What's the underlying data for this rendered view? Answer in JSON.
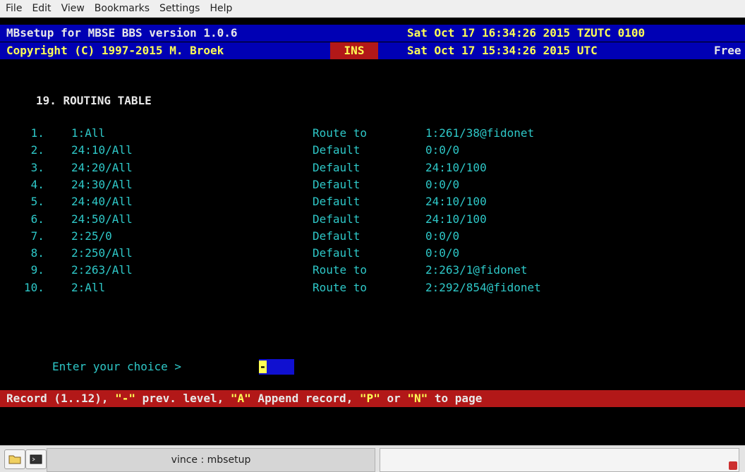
{
  "menu": [
    "File",
    "Edit",
    "View",
    "Bookmarks",
    "Settings",
    "Help"
  ],
  "header": {
    "title": "MBsetup for MBSE BBS version 1.0.6",
    "copyright": "Copyright (C) 1997-2015 M. Broek",
    "mode": "INS",
    "local_time": "Sat Oct 17 16:34:26 2015 TZUTC 0100",
    "utc_time": "Sat Oct 17 15:34:26 2015 UTC",
    "free": "Free"
  },
  "screen_title": "19. ROUTING TABLE",
  "routes": [
    {
      "num": " 1.",
      "pattern": "1:All",
      "action": "Route to",
      "target": "1:261/38@fidonet"
    },
    {
      "num": " 2.",
      "pattern": "24:10/All",
      "action": "Default",
      "target": "0:0/0"
    },
    {
      "num": " 3.",
      "pattern": "24:20/All",
      "action": "Default",
      "target": "24:10/100"
    },
    {
      "num": " 4.",
      "pattern": "24:30/All",
      "action": "Default",
      "target": "0:0/0"
    },
    {
      "num": " 5.",
      "pattern": "24:40/All",
      "action": "Default",
      "target": "24:10/100"
    },
    {
      "num": " 6.",
      "pattern": "24:50/All",
      "action": "Default",
      "target": "24:10/100"
    },
    {
      "num": " 7.",
      "pattern": "2:25/0",
      "action": "Default",
      "target": "0:0/0"
    },
    {
      "num": " 8.",
      "pattern": "2:250/All",
      "action": "Default",
      "target": "0:0/0"
    },
    {
      "num": " 9.",
      "pattern": "2:263/All",
      "action": "Route to",
      "target": "2:263/1@fidonet"
    },
    {
      "num": "10.",
      "pattern": "2:All",
      "action": "Route to",
      "target": "2:292/854@fidonet"
    }
  ],
  "prompt": "Enter your choice >",
  "input_value": "-",
  "status": {
    "p1": "Record (1..12), ",
    "k1": "\"-\"",
    "p2": " prev. level, ",
    "k2": "\"A\"",
    "p3": " Append record, ",
    "k3": "\"P\"",
    "p4": " or ",
    "k4": "\"N\"",
    "p5": " to page"
  },
  "taskbar": {
    "task_label": "vince : mbsetup"
  },
  "colors": {
    "header_bg": "#0000b4",
    "status_bg": "#b21818",
    "text_yellow": "#ffff55",
    "text_cyan": "#2ec8c8"
  }
}
